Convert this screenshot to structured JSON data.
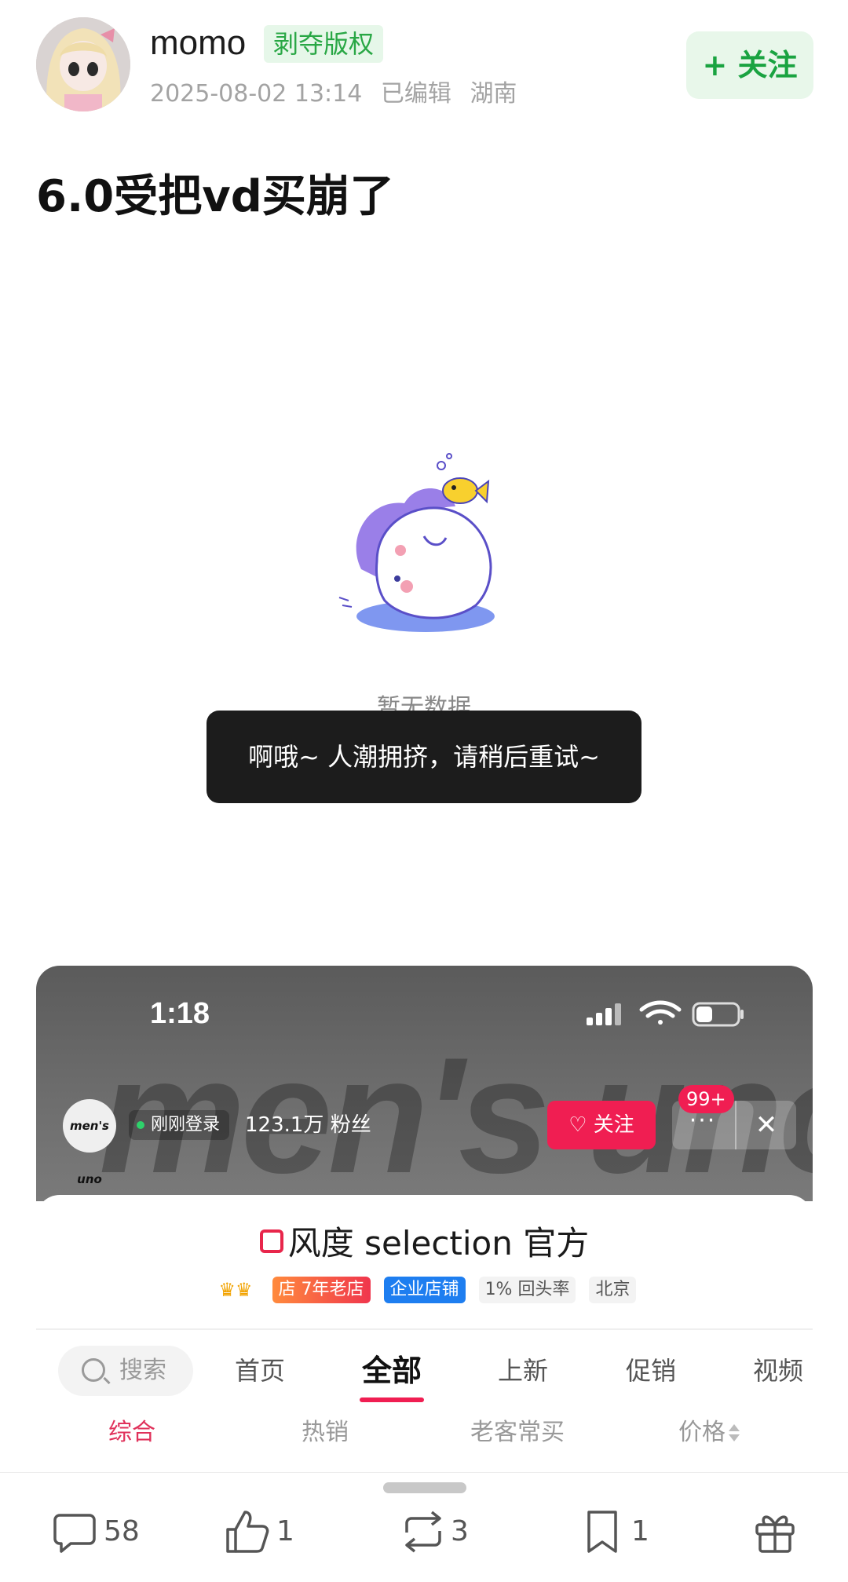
{
  "post": {
    "author": "momo",
    "copyright_badge": "剥夺版权",
    "date": "2025-08-02 13:14",
    "edited": "已编辑",
    "location": "湖南",
    "follow_label": "+ 关注",
    "title": "6.0受把vd买崩了"
  },
  "empty_state": {
    "text": "暂无数据",
    "toast": "啊哦~ 人潮拥挤，请稍后重试~"
  },
  "shop": {
    "status_time": "1:18",
    "banner_watermark": "men's uno",
    "logo_text": "men's uno",
    "online_status": "刚刚登录",
    "fans": "123.1万 粉丝",
    "follow_label": "关注",
    "more_label": "···",
    "notification_badge": "99+",
    "close_label": "✕",
    "name": "风度 selection 官方",
    "tags": {
      "crowns": "♛♛",
      "old_store": "店 7年老店",
      "enterprise": "企业店铺",
      "repurchase": "1% 回头率",
      "city": "北京"
    },
    "search_label": "搜索",
    "tabs": [
      "首页",
      "全部",
      "上新",
      "促销",
      "视频"
    ],
    "active_tab": "全部",
    "sort": [
      "综合",
      "热销",
      "老客常买",
      "价格"
    ],
    "active_sort": "综合"
  },
  "bottom_bar": {
    "comments": "58",
    "likes": "1",
    "reposts": "3",
    "bookmarks": "1"
  },
  "colors": {
    "accent_green": "#1aa341",
    "accent_red": "#f01e52",
    "toast_bg": "#1c1c1c"
  }
}
